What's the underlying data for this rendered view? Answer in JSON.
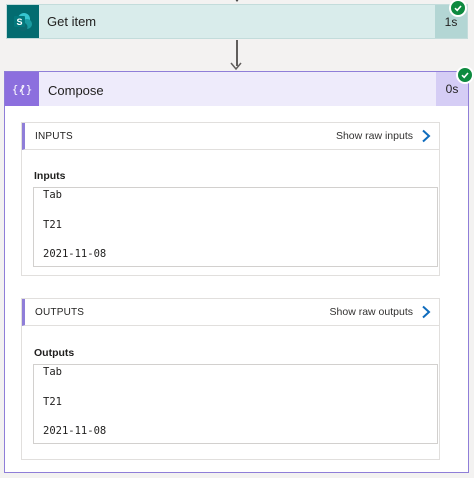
{
  "get_item": {
    "title": "Get item",
    "duration": "1s",
    "icon": "sharepoint-icon",
    "color": "#036c70",
    "status": "succeeded"
  },
  "compose": {
    "title": "Compose",
    "duration": "0s",
    "icon": "compose-braces-icon",
    "color": "#8c6fde",
    "status": "succeeded",
    "inputs": {
      "section_label": "INPUTS",
      "link_label": "Show raw inputs",
      "field_label": "Inputs",
      "lines": [
        "Tab",
        "T21",
        "2021-11-08"
      ]
    },
    "outputs": {
      "section_label": "OUTPUTS",
      "link_label": "Show raw outputs",
      "field_label": "Outputs",
      "lines": [
        "Tab",
        "T21",
        "2021-11-08"
      ]
    }
  }
}
